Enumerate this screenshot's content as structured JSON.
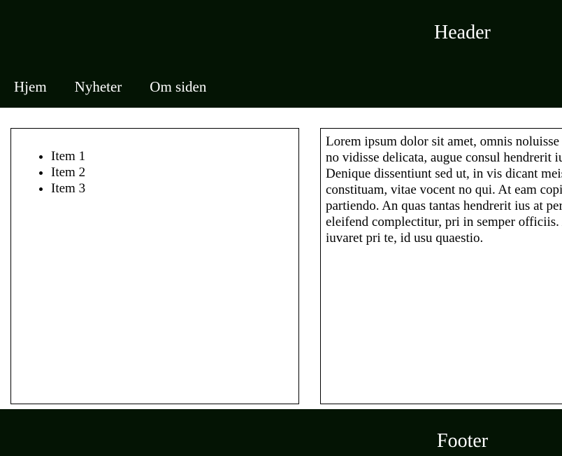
{
  "colors": {
    "header_bg": "#041404",
    "footer_bg": "#041404",
    "text_light": "#ffffff",
    "text_dark": "#000000"
  },
  "header": {
    "title": "Header"
  },
  "nav": {
    "items": [
      {
        "label": "Hjem"
      },
      {
        "label": "Nyheter"
      },
      {
        "label": "Om siden"
      }
    ]
  },
  "sidebar": {
    "items": [
      {
        "label": "Item 1"
      },
      {
        "label": "Item 2"
      },
      {
        "label": "Item 3"
      }
    ]
  },
  "content": {
    "text": "Lorem ipsum dolor sit amet, omnis noluisse et, eos no vidisse delicata, augue consul hendrerit ius ex. Denique dissentiunt sed ut, in vis dicant meis constituam, vitae vocent no qui. At eam copiosae partiendo. An quas tantas hendrerit ius at percipit eleifend complectitur, pri in semper officiis. Affert iuvaret pri te, id usu quaestio."
  },
  "footer": {
    "title": "Footer"
  }
}
